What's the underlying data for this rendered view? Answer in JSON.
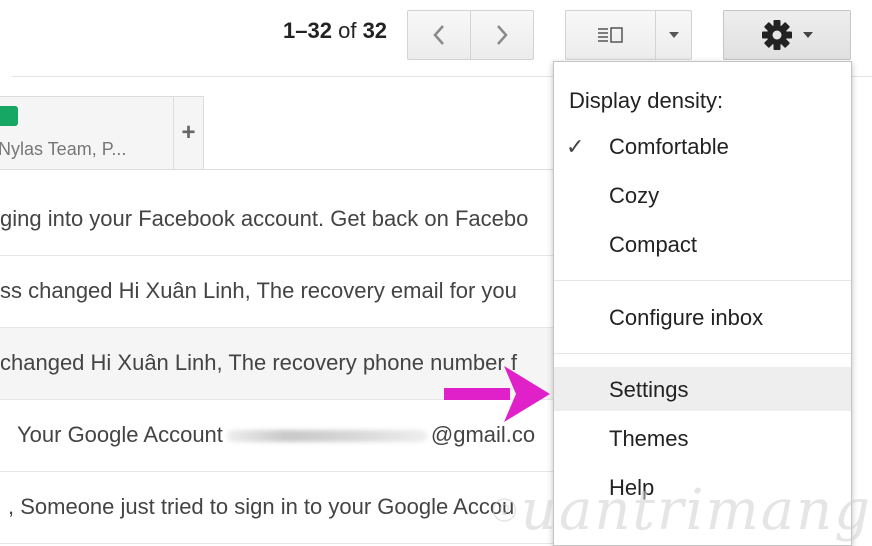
{
  "toolbar": {
    "pager": {
      "range": "1–32",
      "of_word": "of",
      "total": "32"
    },
    "prev_icon": "chevron-left-icon",
    "next_icon": "chevron-right-icon",
    "density_icon": "reading-pane-icon",
    "caret_icon": "caret-down-icon",
    "settings_icon": "gear-icon"
  },
  "tabs": [
    {
      "label": "Nylas Team, P...",
      "color": "#16a765"
    }
  ],
  "add_tab_label": "+",
  "emails": [
    {
      "snippet": "ging into your Facebook account. Get back on Facebo"
    },
    {
      "snippet": "ss changed Hi Xuân Linh, The recovery email for you"
    },
    {
      "snippet": "changed Hi Xuân Linh, The recovery phone number f"
    },
    {
      "snippet_before": "Your Google Account",
      "snippet_after": "@gmail.co"
    },
    {
      "snippet": ", Someone just tried to sign in to your Google Accou"
    }
  ],
  "settings_menu": {
    "heading": "Display density:",
    "density_options": [
      {
        "label": "Comfortable",
        "checked": true
      },
      {
        "label": "Cozy",
        "checked": false
      },
      {
        "label": "Compact",
        "checked": false
      }
    ],
    "configure_inbox": "Configure inbox",
    "settings": "Settings",
    "themes": "Themes",
    "help": "Help",
    "check_mark": "✓"
  },
  "annotation": {
    "arrow_color": "#e020c8"
  },
  "watermark": {
    "text": "uantrimang"
  }
}
